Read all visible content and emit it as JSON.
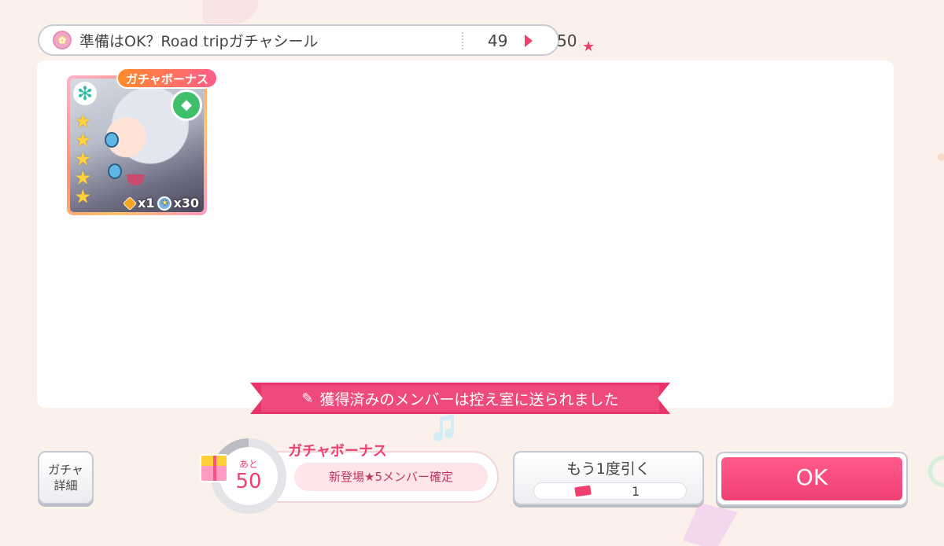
{
  "header": {
    "title": "準備はOK？Road tripガチャシール",
    "count_from": "49",
    "count_to": "50"
  },
  "card": {
    "bonus_tag": "ガチャボーナス",
    "rarity_stars": 5,
    "star_glyph": "★",
    "item_count": "x1",
    "star_count": "x30"
  },
  "ribbon": {
    "message": "獲得済みのメンバーは控え室に送られました"
  },
  "buttons": {
    "detail_line1": "ガチャ",
    "detail_line2": "詳細",
    "again_label": "もう1度引く",
    "again_cost": "1",
    "ok_label": "OK"
  },
  "bonus": {
    "remaining_label": "あと",
    "remaining_count": "50",
    "title": "ガチャボーナス",
    "description": "新登場★5メンバー確定"
  },
  "colors": {
    "accent": "#ee3f6e",
    "background": "#fbf0ea",
    "ok_button": "#f04074"
  }
}
